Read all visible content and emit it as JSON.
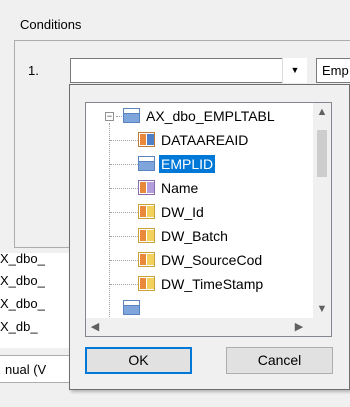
{
  "conditions": {
    "title": "Conditions",
    "row_number": "1.",
    "field_value": "",
    "operator_value": "Emp"
  },
  "background_list": {
    "items": [
      "X_dbo_",
      "X_dbo_",
      "X_dbo_",
      "X_db_"
    ],
    "manual_text": "nual (V"
  },
  "tree": {
    "root": {
      "label": "AX_dbo_EMPLTABL",
      "expanded": true
    },
    "children": [
      {
        "label": "DATAAREAID",
        "icon": "key-field-icon",
        "selected": false
      },
      {
        "label": "EMPLID",
        "icon": "table-icon",
        "selected": true
      },
      {
        "label": "Name",
        "icon": "field-icon-purple",
        "selected": false
      },
      {
        "label": "DW_Id",
        "icon": "field-icon-yellow",
        "selected": false
      },
      {
        "label": "DW_Batch",
        "icon": "field-icon-yellow",
        "selected": false
      },
      {
        "label": "DW_SourceCod",
        "icon": "field-icon-yellow",
        "selected": false
      },
      {
        "label": "DW_TimeStamp",
        "icon": "field-icon-yellow",
        "selected": false
      }
    ]
  },
  "buttons": {
    "ok_label": "OK",
    "cancel_label": "Cancel"
  },
  "colors": {
    "selection": "#0078d7",
    "window_bg": "#f0f0f0"
  }
}
